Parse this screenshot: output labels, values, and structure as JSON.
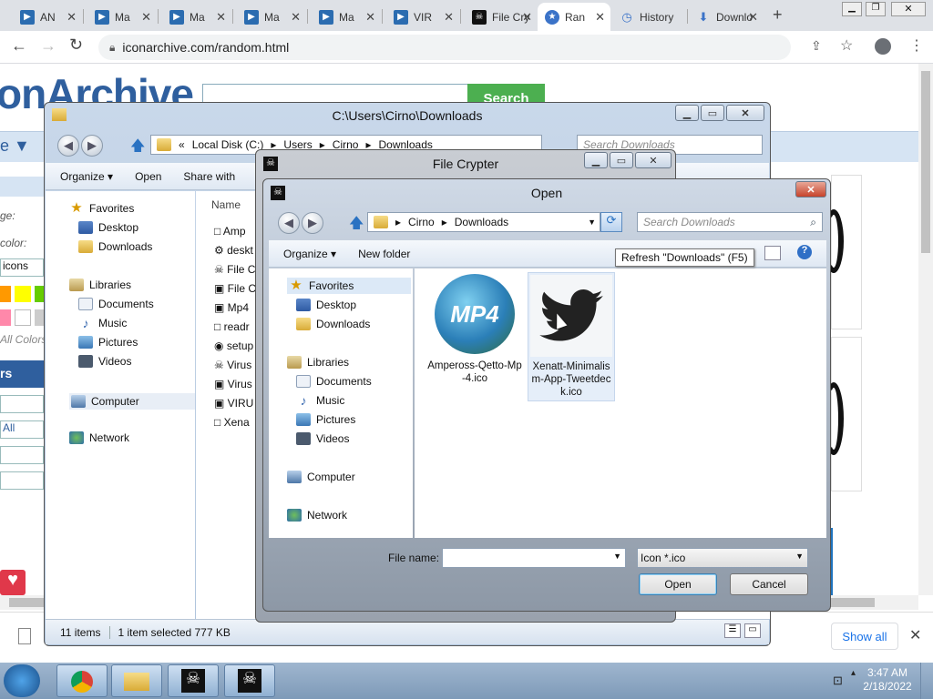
{
  "browser": {
    "tabs": [
      {
        "title": "AN",
        "fav": "video-icon"
      },
      {
        "title": "Ma",
        "fav": "video-icon"
      },
      {
        "title": "Ma",
        "fav": "video-icon"
      },
      {
        "title": "Ma",
        "fav": "video-icon"
      },
      {
        "title": "Ma",
        "fav": "video-icon"
      },
      {
        "title": "VIR",
        "fav": "video-icon"
      },
      {
        "title": "File Cry",
        "fav": "skull-icon"
      },
      {
        "title": "Ran",
        "fav": "star-icon"
      },
      {
        "title": "History",
        "fav": "history-icon"
      },
      {
        "title": "Downlo",
        "fav": "download-icon"
      }
    ],
    "url": "iconarchive.com/random.html"
  },
  "webpage": {
    "logo_text": "onArchive",
    "search_button": "Search",
    "left_labels": [
      "ge:",
      "color:",
      "icons"
    ],
    "all_colors": "All Colors",
    "rs": "rs",
    "all": "All",
    "show_all": "Show all"
  },
  "explorer": {
    "title": "C:\\Users\\Cirno\\Downloads",
    "path": [
      "Local Disk (C:)",
      "Users",
      "Cirno",
      "Downloads"
    ],
    "search_placeholder": "Search Downloads",
    "organize": "Organize",
    "open": "Open",
    "share": "Share with",
    "nav": {
      "favorites": "Favorites",
      "desktop": "Desktop",
      "downloads": "Downloads",
      "libraries": "Libraries",
      "documents": "Documents",
      "music": "Music",
      "pictures": "Pictures",
      "videos": "Videos",
      "computer": "Computer",
      "network": "Network"
    },
    "col_name": "Name",
    "files": [
      "Amp",
      "deskt",
      "File C",
      "File C",
      "Mp4",
      "readr",
      "setup",
      "Virus",
      "Virus",
      "VIRU",
      "Xena"
    ],
    "status_count": "11 items",
    "status_selected": "1 item selected  777 KB"
  },
  "crypter": {
    "title": "File Crypter"
  },
  "open_dialog": {
    "title": "Open",
    "path": [
      "Cirno",
      "Downloads"
    ],
    "search_placeholder": "Search Downloads",
    "organize": "Organize",
    "new_folder": "New folder",
    "tooltip": "Refresh \"Downloads\" (F5)",
    "nav": {
      "favorites": "Favorites",
      "desktop": "Desktop",
      "downloads": "Downloads",
      "libraries": "Libraries",
      "documents": "Documents",
      "music": "Music",
      "pictures": "Pictures",
      "videos": "Videos",
      "computer": "Computer",
      "network": "Network"
    },
    "files": [
      {
        "name": "Ampeross-Qetto-Mp-4.ico",
        "badge": "MP4"
      },
      {
        "name": "Xenatt-Minimalism-App-Tweetdeck.ico",
        "badge": ""
      }
    ],
    "filename_label": "File name:",
    "filename_value": "",
    "filetype": "Icon *.ico",
    "open_btn": "Open",
    "cancel_btn": "Cancel"
  },
  "taskbar": {
    "time": "3:47 AM",
    "date": "2/18/2022"
  }
}
